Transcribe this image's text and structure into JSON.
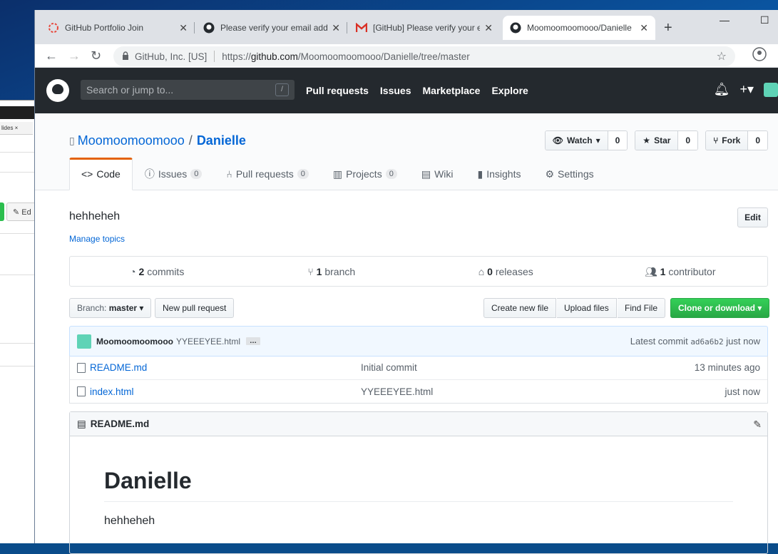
{
  "back_window": {
    "tab_label": "lides",
    "edit_label": "Ed"
  },
  "browser": {
    "tabs": [
      {
        "title": "GitHub Portfolio Join",
        "icon": "portfolio-icon"
      },
      {
        "title": "Please verify your email addre",
        "icon": "github-icon"
      },
      {
        "title": "[GitHub] Please verify your em",
        "icon": "gmail-icon"
      },
      {
        "title": "Moomoomoomooo/Danielle",
        "icon": "github-icon"
      }
    ],
    "site_identity": "GitHub, Inc. [US]",
    "url_prefix": "https://",
    "url_host": "github.com",
    "url_path": "/Moomoomoomooo/Danielle/tree/master"
  },
  "github": {
    "search_placeholder": "Search or jump to...",
    "search_shortcut": "/",
    "nav": [
      "Pull requests",
      "Issues",
      "Marketplace",
      "Explore"
    ]
  },
  "repo": {
    "owner": "Moomoomoomooo",
    "separator": "/",
    "name": "Danielle",
    "watch": {
      "label": "Watch",
      "count": "0"
    },
    "star": {
      "label": "Star",
      "count": "0"
    },
    "fork": {
      "label": "Fork",
      "count": "0"
    },
    "tabs": {
      "code": "Code",
      "issues": "Issues",
      "issues_count": "0",
      "pulls": "Pull requests",
      "pulls_count": "0",
      "projects": "Projects",
      "projects_count": "0",
      "wiki": "Wiki",
      "insights": "Insights",
      "settings": "Settings"
    },
    "description": "hehheheh",
    "manage_topics": "Manage topics",
    "edit_label": "Edit",
    "summary": {
      "commits_n": "2",
      "commits_label": "commits",
      "branch_n": "1",
      "branch_label": "branch",
      "releases_n": "0",
      "releases_label": "releases",
      "contrib_n": "1",
      "contrib_label": "contributor"
    },
    "branch_label": "Branch:",
    "branch_name": "master",
    "new_pr": "New pull request",
    "create_file": "Create new file",
    "upload_files": "Upload files",
    "find_file": "Find File",
    "clone": "Clone or download",
    "commit": {
      "author": "Moomoomoomooo",
      "message": "YYEEEYEE.html",
      "ellipsis": "…",
      "latest_label": "Latest commit",
      "sha": "ad6a6b2",
      "when": "just now"
    },
    "files": [
      {
        "name": "README.md",
        "message": "Initial commit",
        "age": "13 minutes ago"
      },
      {
        "name": "index.html",
        "message": "YYEEEYEE.html",
        "age": "just now"
      }
    ],
    "readme": {
      "file": "README.md",
      "heading": "Danielle",
      "body": "hehheheh"
    }
  }
}
